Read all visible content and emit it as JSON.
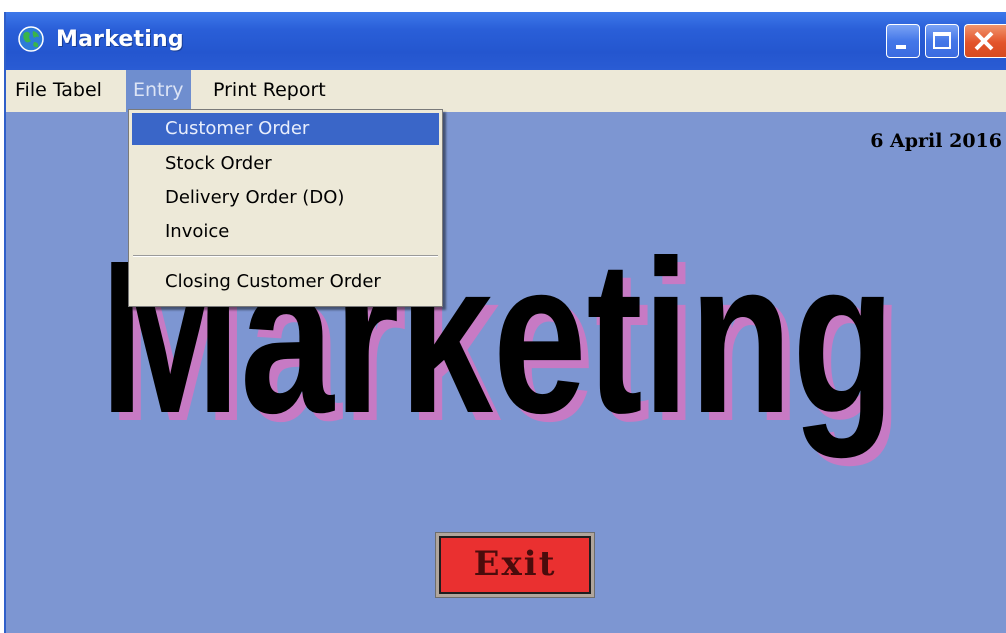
{
  "window": {
    "title": "Marketing",
    "app_icon": "globe-icon",
    "controls": [
      "minimize-icon",
      "maximize-icon",
      "close-icon"
    ]
  },
  "menubar": {
    "items": [
      {
        "label": "File Tabel"
      },
      {
        "label": "Entry",
        "state": "open"
      },
      {
        "label": "Print Report"
      }
    ]
  },
  "dropdown": {
    "items": [
      {
        "label": "Customer Order",
        "selected": true
      },
      {
        "label": "Stock Order"
      },
      {
        "label": "Delivery Order (DO)"
      },
      {
        "label": "Invoice"
      },
      {
        "label": "Closing Customer Order"
      }
    ]
  },
  "main": {
    "date": "6 April 2016",
    "banner": "Marketing",
    "exit_label": "Exit"
  },
  "colors": {
    "background": "#7d96d2",
    "banner_fill": "#000000",
    "banner_shadow": "#c77ac4",
    "exit_button": "#ea3030",
    "selection": "#3a66c8"
  }
}
